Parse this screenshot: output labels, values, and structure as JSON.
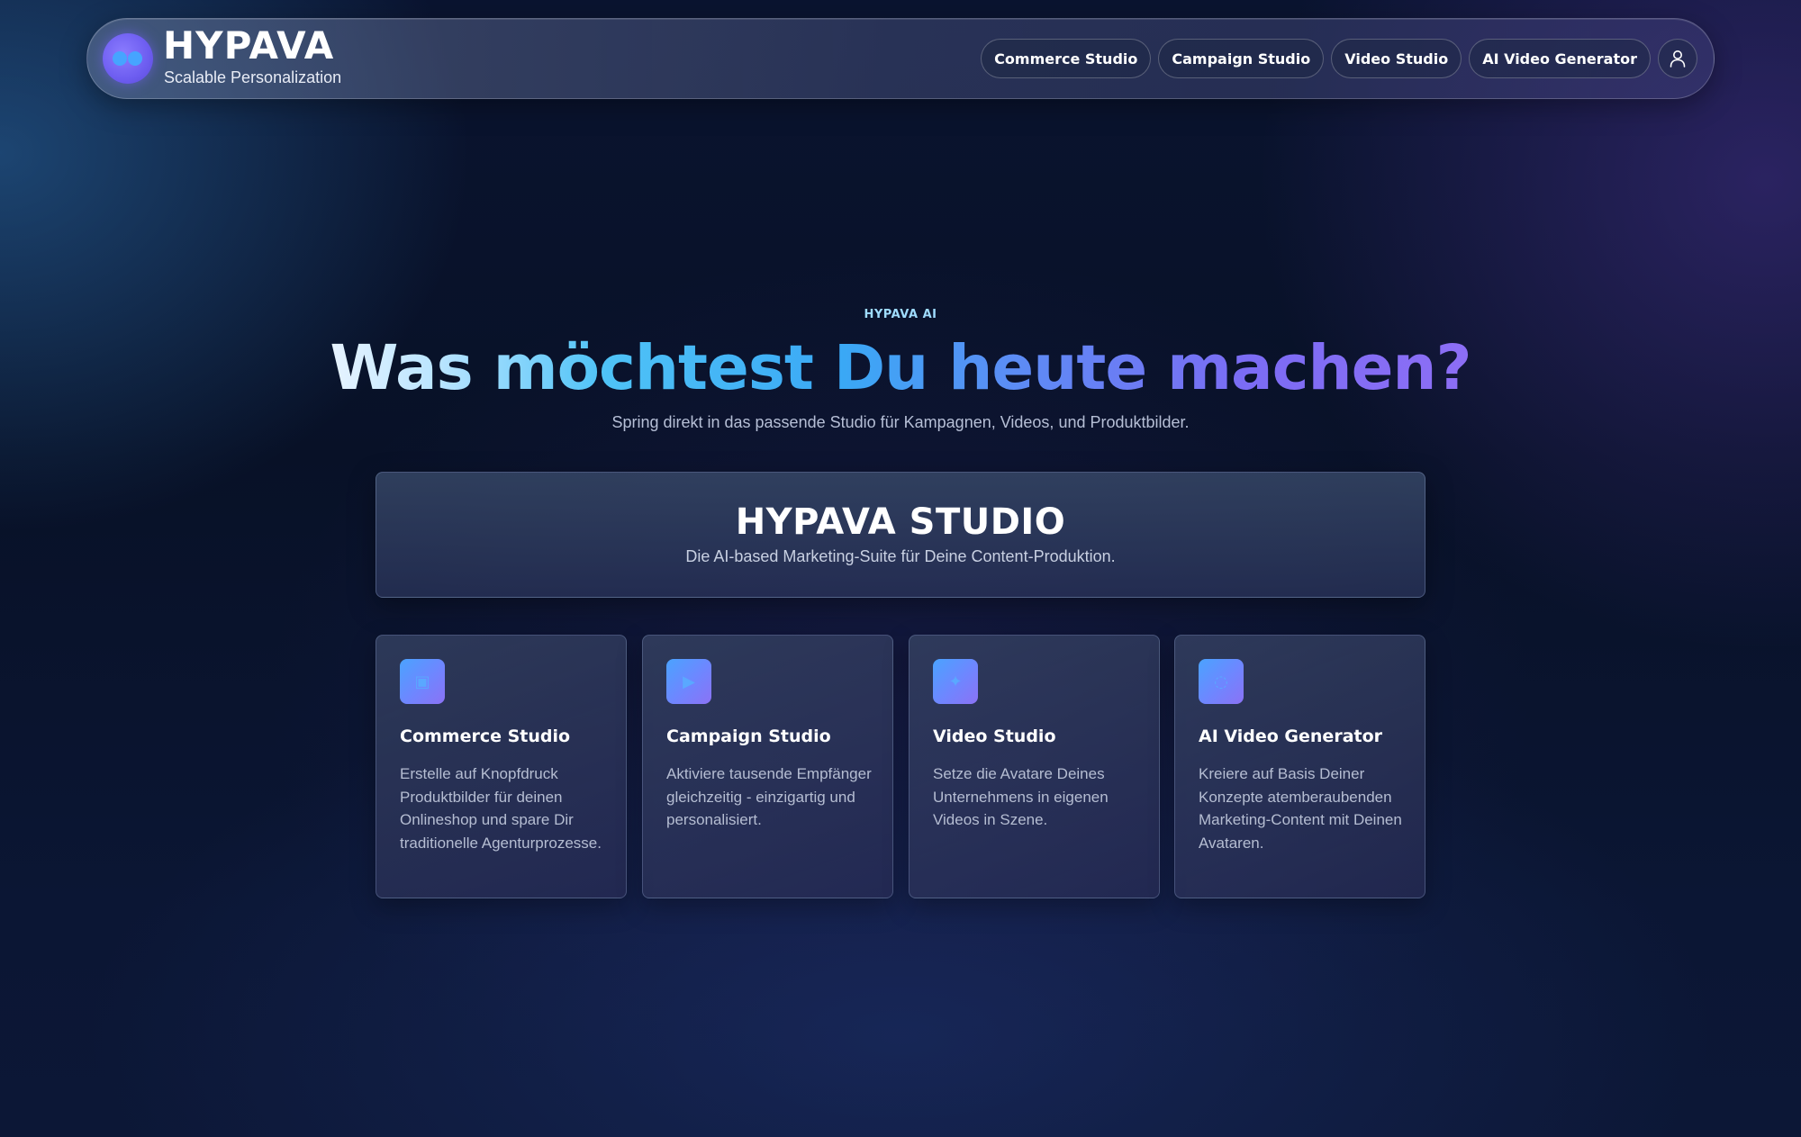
{
  "header": {
    "brand_name": "HYPAVA",
    "brand_tagline": "Scalable Personalization",
    "nav": [
      {
        "label": "Commerce Studio"
      },
      {
        "label": "Campaign Studio"
      },
      {
        "label": "Video Studio"
      },
      {
        "label": "AI Video Generator"
      }
    ],
    "user_icon": "user-icon"
  },
  "hero": {
    "eyebrow": "HYPAVA AI",
    "headline": "Was möchtest Du heute machen?",
    "subline": "Spring direkt in das passende Studio für Kampagnen, Videos, und Produktbilder."
  },
  "studio": {
    "title": "HYPAVA STUDIO",
    "subtitle": "Die AI-based Marketing-Suite für Deine Content-Produktion."
  },
  "cards": [
    {
      "title": "Commerce Studio",
      "text": "Erstelle auf Knopfdruck Produktbilder für deinen Onlineshop und spare Dir traditionelle Agenturprozesse.",
      "icon": "square-icon",
      "glyph": "▣"
    },
    {
      "title": "Campaign Studio",
      "text": "Aktiviere tausende Empfänger gleichzeitig - einzigartig und personalisiert.",
      "icon": "play-icon",
      "glyph": "▶"
    },
    {
      "title": "Video Studio",
      "text": "Setze die Avatare Deines Unternehmens in eigenen Videos in Szene.",
      "icon": "sparkle-icon",
      "glyph": "✦"
    },
    {
      "title": "AI Video Generator",
      "text": "Kreiere auf Basis Deiner Konzepte atemberaubenden Marketing-Content mit Deinen Avataren.",
      "icon": "circle-icon",
      "glyph": "◌"
    }
  ],
  "colors": {
    "accent_blue": "#4fc3f7",
    "accent_purple": "#8d6ef5",
    "background": "#081127"
  }
}
